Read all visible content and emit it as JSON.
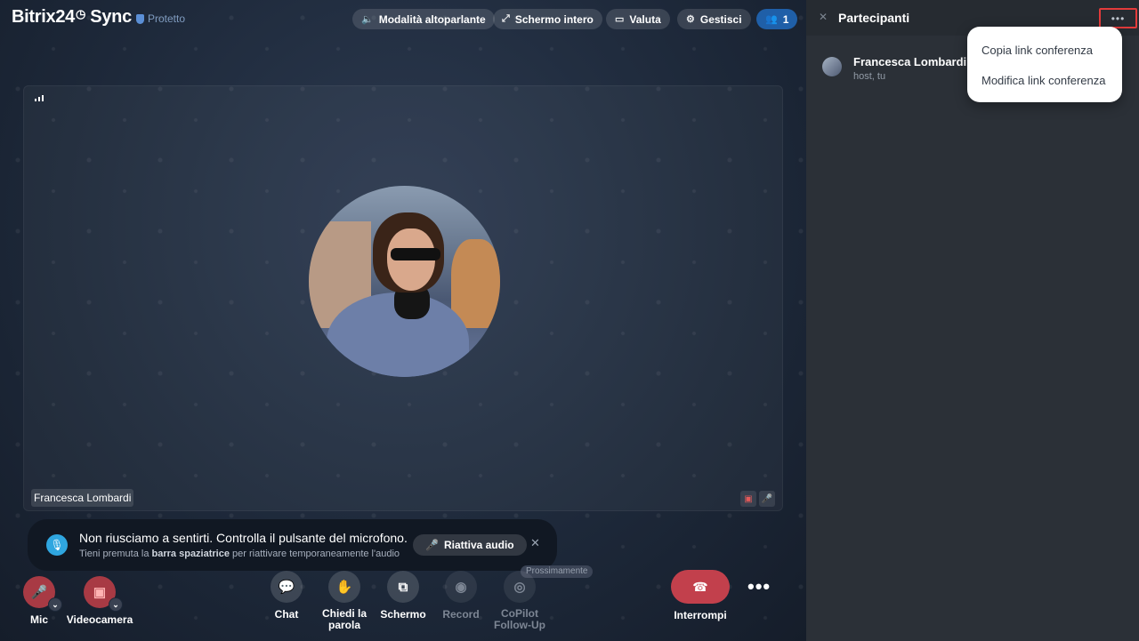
{
  "header": {
    "logo_text": "Bitrix24",
    "logo_suffix": "Sync",
    "protected_label": "Protetto",
    "buttons": {
      "speaker": "Modalità altoparlante",
      "fullscreen": "Schermo intero",
      "rate": "Valuta",
      "manage": "Gestisci",
      "participants_count": "1"
    }
  },
  "tile": {
    "participant_name": "Francesca Lombardi"
  },
  "notification": {
    "title": "Non riusciamo a sentirti. Controlla il pulsante del microfono.",
    "sub_prefix": "Tieni premuta la",
    "sub_key": "barra spaziatrice",
    "sub_suffix": "per riattivare temporaneamente l'audio",
    "action": "Riattiva audio"
  },
  "soon_badge": "Prossimamente",
  "controls": {
    "mic": "Mic",
    "camera": "Videocamera",
    "chat": "Chat",
    "raise_hand_1": "Chiedi la",
    "raise_hand_2": "parola",
    "screen": "Schermo",
    "record": "Record",
    "copilot_1": "CoPilot",
    "copilot_2": "Follow-Up",
    "hangup": "Interrompi"
  },
  "panel": {
    "title": "Partecipanti",
    "participant": {
      "name": "Francesca Lombardi",
      "role": "host, tu"
    },
    "menu": {
      "copy_link": "Copia link conferenza",
      "edit_link": "Modifica link conferenza"
    }
  },
  "colors": {
    "accent_blue": "#1f5fa8",
    "hangup_red": "#c2404c",
    "highlight_red": "#e23b3b"
  }
}
